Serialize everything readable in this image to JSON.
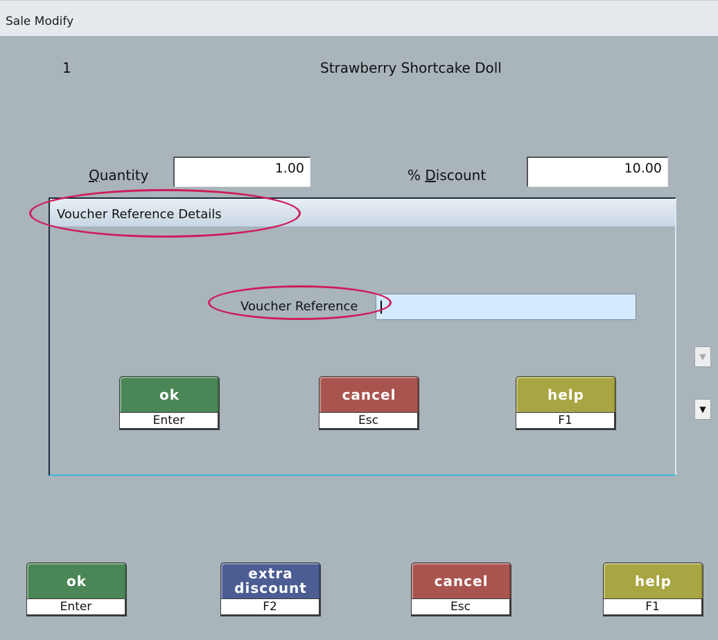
{
  "window": {
    "title": "Sale Modify"
  },
  "item": {
    "line_number": "1",
    "description": "Strawberry Shortcake Doll"
  },
  "fields": {
    "quantity_label_prefix": "",
    "quantity_label_ul": "Q",
    "quantity_label_rest": "uantity",
    "quantity_value": "1.00",
    "discount_label_prefix": "% ",
    "discount_label_ul": "D",
    "discount_label_rest": "iscount",
    "discount_value": "10.00"
  },
  "dialog": {
    "title": "Voucher Reference Details",
    "voucher_label": "Voucher Reference",
    "voucher_value": "",
    "buttons": {
      "ok": {
        "label": "ok",
        "key": "Enter"
      },
      "cancel": {
        "label": "cancel",
        "key": "Esc"
      },
      "help": {
        "label": "help",
        "key": "F1"
      }
    }
  },
  "footer_buttons": {
    "ok": {
      "label": "ok",
      "key": "Enter"
    },
    "extra_discount": {
      "label_line1": "extra",
      "label_line2": "discount",
      "key": "F2"
    },
    "cancel": {
      "label": "cancel",
      "key": "Esc"
    },
    "help": {
      "label": "help",
      "key": "F1"
    }
  },
  "icons": {
    "dropdown_disabled": "chevron-down-icon",
    "dropdown_enabled": "chevron-down-icon"
  },
  "colors": {
    "background": "#a9b4bb",
    "ok_green": "#4b8656",
    "cancel_red": "#a9554f",
    "help_olive": "#a8a543",
    "extra_blue": "#4c5d94",
    "annotation": "#cf1c5a",
    "voucher_input": "#d4ebff"
  }
}
